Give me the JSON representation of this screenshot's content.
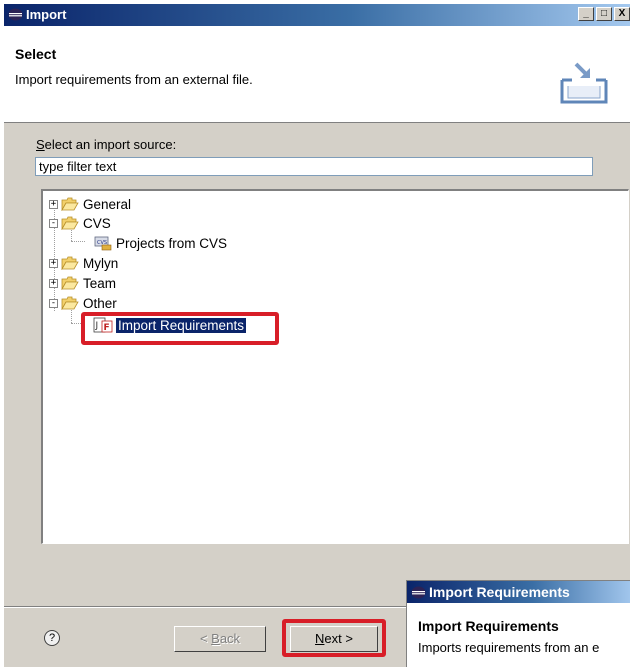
{
  "window": {
    "title": "Import",
    "minimize_glyph": "_",
    "maximize_glyph": "□",
    "close_glyph": "X"
  },
  "header": {
    "title": "Select",
    "description": "Import requirements from an external file."
  },
  "source_label_accel": "S",
  "source_label_rest": "elect an import source:",
  "filter": {
    "value": "type filter text"
  },
  "tree": {
    "general": "General",
    "cvs": "CVS",
    "projects_from_cvs": "Projects from CVS",
    "mylyn": "Mylyn",
    "team": "Team",
    "other": "Other",
    "import_requirements": "Import Requirements"
  },
  "buttons": {
    "back_prefix": "< ",
    "back_accel": "B",
    "back_rest": "ack",
    "next_accel": "N",
    "next_rest": "ext >"
  },
  "popup": {
    "title": "Import Requirements",
    "body_title": "Import Requirements",
    "body_desc": "Imports requirements from an e"
  },
  "colors": {
    "title_bar": "#0a246a",
    "selection": "#0a246a",
    "highlight": "#d81e28",
    "dialog_bg": "#d4d0c8"
  },
  "icons": {
    "title": "eclipse-icon",
    "header": "import-wizard-icon",
    "folder": "folder-open-icon",
    "cvs_project": "cvs-project-icon",
    "requirements": "requirements-file-icon",
    "help": "help-icon"
  }
}
